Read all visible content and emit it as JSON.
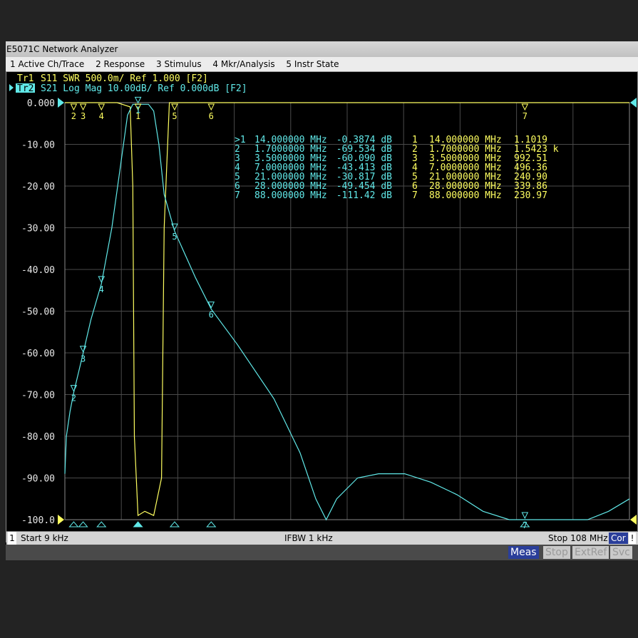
{
  "window": {
    "title": "E5071C Network Analyzer"
  },
  "menu": [
    "1 Active Ch/Trace",
    "2 Response",
    "3 Stimulus",
    "4 Mkr/Analysis",
    "5 Instr State"
  ],
  "traces": {
    "tr1": {
      "label": "Tr1",
      "text": "S11  SWR 500.0m/ Ref 1.000 [F2]"
    },
    "tr2": {
      "label": "Tr2",
      "text": "S21  Log Mag 10.00dB/ Ref 0.000dB [F2]"
    }
  },
  "status": {
    "channel": "1",
    "start": "Start 9 kHz",
    "ifbw": "IFBW 1 kHz",
    "stop": "Stop 108 MHz",
    "cor": "Cor",
    "alert": "!"
  },
  "bottom": {
    "meas": "Meas",
    "stop": "Stop",
    "extref": "ExtRef",
    "svc": "Svc"
  },
  "colors": {
    "tr1": "#ffff60",
    "tr2": "#60e8e8",
    "grid": "#4a4a4a",
    "background": "#000000"
  },
  "chart_data": {
    "type": "line",
    "x_range_mhz": [
      0.009,
      108
    ],
    "ylim": [
      -100,
      0
    ],
    "y_ticks": [
      "0.000",
      "-10.00",
      "-20.00",
      "-30.00",
      "-40.00",
      "-50.00",
      "-60.00",
      "-70.00",
      "-80.00",
      "-90.00",
      "-100.0"
    ],
    "grid": true,
    "series": [
      {
        "name": "Tr1",
        "x": [
          0.009,
          10,
          12.5,
          13,
          13.3,
          14,
          15.3,
          17,
          18.5,
          19,
          20,
          25,
          50,
          80,
          108
        ],
        "y": [
          0,
          0,
          -1,
          -20,
          -80,
          -99,
          -98,
          -99,
          -90,
          -30,
          0,
          0,
          0,
          0,
          0
        ]
      },
      {
        "name": "Tr2",
        "x": [
          0.009,
          0.3,
          1,
          1.7,
          3.5,
          5,
          7,
          9,
          11,
          12,
          13,
          14,
          15,
          16,
          17,
          18,
          19,
          21,
          25,
          28,
          33,
          40,
          45,
          48,
          50,
          52,
          56,
          60,
          65,
          70,
          75,
          80,
          85,
          100,
          104,
          108
        ],
        "y": [
          -89,
          -80,
          -74,
          -69.5,
          -60.1,
          -52,
          -43.4,
          -30,
          -12,
          -3,
          -0.4,
          -0.4,
          -0.4,
          -0.4,
          -2,
          -10,
          -22,
          -30.8,
          -42,
          -49.5,
          -58,
          -71,
          -84,
          -95,
          -100,
          -95,
          -90,
          -89,
          -89,
          -91,
          -94,
          -98,
          -100,
          -100,
          -98,
          -95
        ]
      }
    ],
    "markers_tr2": [
      {
        "id": ">1",
        "freq": "14.000000 MHz",
        "value": "-0.3874 dB"
      },
      {
        "id": "2",
        "freq": "1.7000000 MHz",
        "value": "-69.534 dB"
      },
      {
        "id": "3",
        "freq": "3.5000000 MHz",
        "value": "-60.090 dB"
      },
      {
        "id": "4",
        "freq": "7.0000000 MHz",
        "value": "-43.413 dB"
      },
      {
        "id": "5",
        "freq": "21.000000 MHz",
        "value": "-30.817 dB"
      },
      {
        "id": "6",
        "freq": "28.000000 MHz",
        "value": "-49.454 dB"
      },
      {
        "id": "7",
        "freq": "88.000000 MHz",
        "value": "-111.42 dB"
      }
    ],
    "markers_tr1": [
      {
        "id": "1",
        "freq": "14.000000 MHz",
        "value": "1.1019"
      },
      {
        "id": "2",
        "freq": "1.7000000 MHz",
        "value": "1.5423 k"
      },
      {
        "id": "3",
        "freq": "3.5000000 MHz",
        "value": "992.51"
      },
      {
        "id": "4",
        "freq": "7.0000000 MHz",
        "value": "496.36"
      },
      {
        "id": "5",
        "freq": "21.000000 MHz",
        "value": "240.90"
      },
      {
        "id": "6",
        "freq": "28.000000 MHz",
        "value": "339.86"
      },
      {
        "id": "7",
        "freq": "88.000000 MHz",
        "value": "230.97"
      }
    ],
    "marker_positions": [
      {
        "id": "1",
        "freq": 14,
        "tr2": -0.4
      },
      {
        "id": "2",
        "freq": 1.7,
        "tr2": -69.5
      },
      {
        "id": "3",
        "freq": 3.5,
        "tr2": -60.1
      },
      {
        "id": "4",
        "freq": 7,
        "tr2": -43.4
      },
      {
        "id": "5",
        "freq": 21,
        "tr2": -30.8
      },
      {
        "id": "6",
        "freq": 28,
        "tr2": -49.5
      },
      {
        "id": "7",
        "freq": 88,
        "tr2": -100
      }
    ]
  }
}
